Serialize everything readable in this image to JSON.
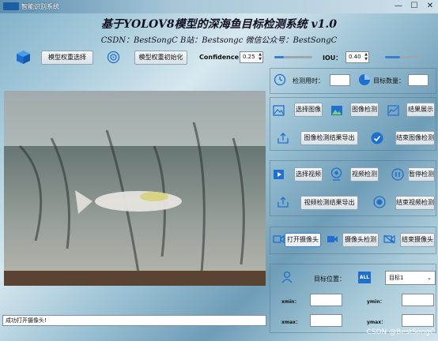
{
  "window": {
    "title": "智能识别系统",
    "minimize": "—",
    "maximize": "☐",
    "close": "✕"
  },
  "header": {
    "title": "基于YOLOV8模型的深海鱼目标检测系统 v1.0",
    "subtitle": "CSDN：BestSongC   B站：Bestsongc   微信公众号：BestSongC"
  },
  "toolbar": {
    "model_select": "模型权重选择",
    "model_init": "模型权重初始化",
    "confidence_label": "Confidence",
    "confidence_value": "0.25",
    "confidence_level": 0.25,
    "iou_label": "IOU：",
    "iou_value": "0.40",
    "iou_level": 0.4
  },
  "stats": {
    "time_label": "检测用时：",
    "time_value": "",
    "count_label": "目标数量：",
    "count_value": ""
  },
  "image_ops": {
    "select": "选择图像",
    "detect": "图像检测",
    "show": "结果展示",
    "export": "图像检测结果导出",
    "end": "结束图像检测"
  },
  "video_ops": {
    "select": "选择视频",
    "detect": "视频检测",
    "pause": "暂停检测",
    "export": "视频检测结果导出",
    "end": "结束视频检测"
  },
  "camera_ops": {
    "open": "打开摄像头",
    "detect": "摄像头检测",
    "end": "结束摄像头"
  },
  "target": {
    "position_label": "目标位置：",
    "all_badge": "ALL",
    "selected": "目标1",
    "xmin_label": "xmin：",
    "ymin_label": "ymin：",
    "xmax_label": "xmax：",
    "ymax_label": "ymax：",
    "xmin": "",
    "ymin": "",
    "xmax": "",
    "ymax": ""
  },
  "status": {
    "message": "成功打开摄像头!"
  },
  "watermark": "CSDN @BestSongC",
  "colors": {
    "accent": "#3a7bd5",
    "icon_blue": "#1f6fd0"
  }
}
